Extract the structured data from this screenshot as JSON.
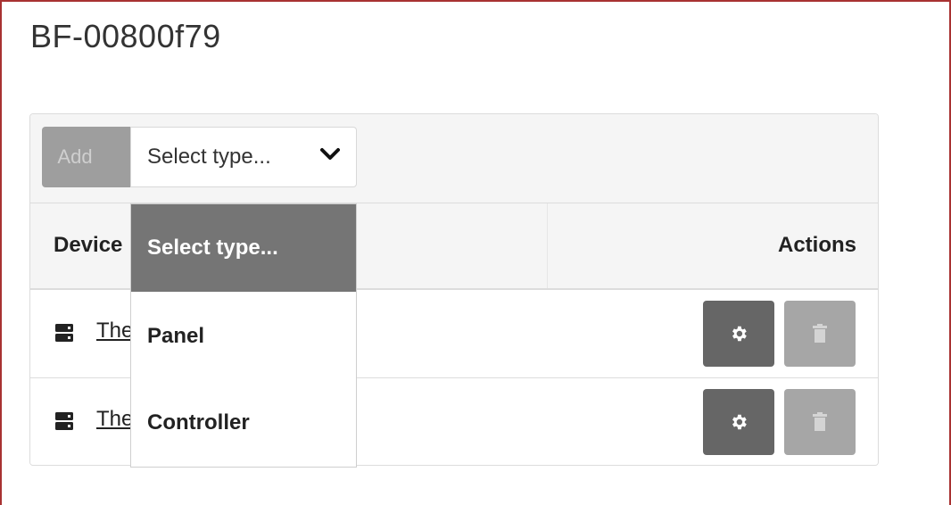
{
  "page": {
    "title": "BF-00800f79"
  },
  "toolbar": {
    "add_label": "Add",
    "select_value": "Select type..."
  },
  "table": {
    "headers": {
      "device": "Device",
      "actions": "Actions"
    },
    "rows": [
      {
        "device": "The",
        "icon": "server-icon"
      },
      {
        "device": "The",
        "icon": "server-icon"
      }
    ]
  },
  "dropdown": {
    "options": [
      "Select type...",
      "Panel",
      "Controller"
    ],
    "selected": "Select type..."
  },
  "colors": {
    "frame": "#a83232",
    "add_disabled": "#9e9e9e",
    "dropdown_highlight": "#757575",
    "settings_button": "#666666",
    "delete_disabled": "#a6a6a6"
  }
}
